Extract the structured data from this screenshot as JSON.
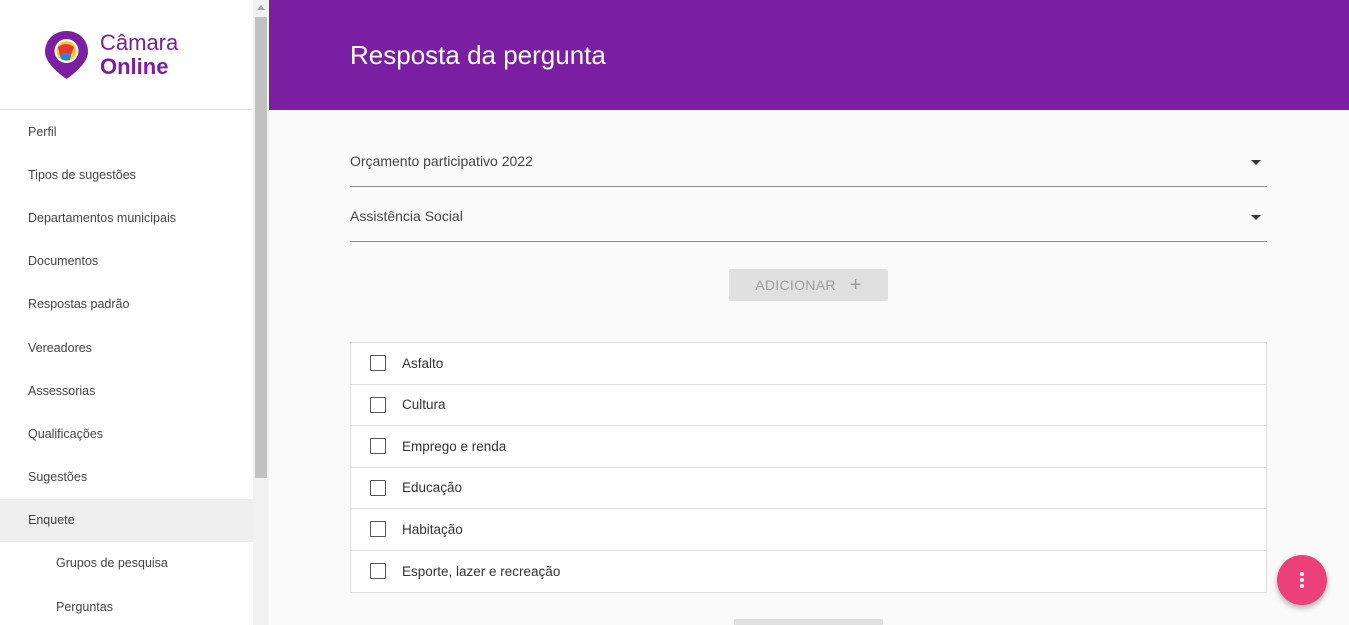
{
  "app": {
    "logo_line1": "Câmara",
    "logo_line2": "Online",
    "brand_color": "#7b1fa2",
    "accent_color": "#ec407a"
  },
  "sidebar": {
    "items": [
      {
        "label": "Perfil"
      },
      {
        "label": "Tipos de sugestões"
      },
      {
        "label": "Departamentos municipais"
      },
      {
        "label": "Documentos"
      },
      {
        "label": "Respostas padrão"
      },
      {
        "label": "Vereadores"
      },
      {
        "label": "Assessorias"
      },
      {
        "label": "Qualificações"
      },
      {
        "label": "Sugestões"
      },
      {
        "label": "Enquete",
        "active": true
      },
      {
        "label": "Grupos de pesquisa",
        "sub": true
      },
      {
        "label": "Perguntas",
        "sub": true
      }
    ]
  },
  "header": {
    "title": "Resposta da pergunta"
  },
  "form": {
    "select1_value": "Orçamento participativo 2022",
    "select2_value": "Assistência Social",
    "add_label": "ADICIONAR",
    "add_icon": "plus-icon"
  },
  "options": [
    {
      "label": "Asfalto",
      "checked": false
    },
    {
      "label": "Cultura",
      "checked": false
    },
    {
      "label": "Emprego e renda",
      "checked": false
    },
    {
      "label": "Educação",
      "checked": false
    },
    {
      "label": "Habitação",
      "checked": false
    },
    {
      "label": "Esporte, lazer e recreação",
      "checked": false
    }
  ],
  "fab": {
    "icon": "more-vert-icon"
  }
}
